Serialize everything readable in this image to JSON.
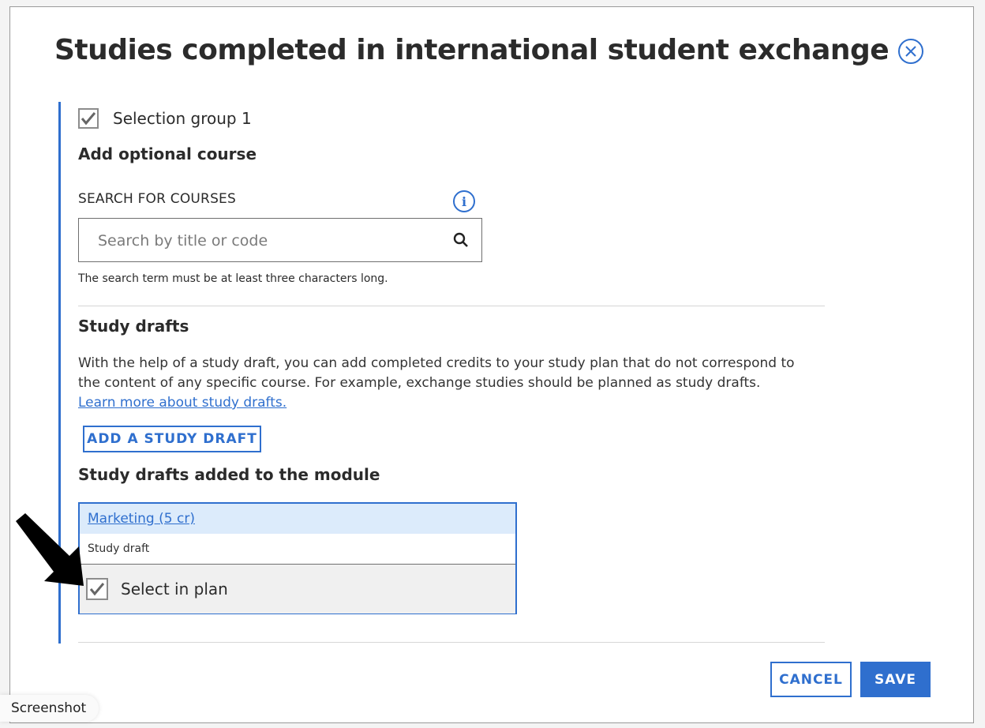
{
  "modal": {
    "title": "Studies completed in international student exchange"
  },
  "selection_group": {
    "label": "Selection group 1",
    "checked": true
  },
  "add_course": {
    "heading": "Add optional course",
    "search_label": "SEARCH FOR COURSES",
    "search_placeholder": "Search by title or code",
    "search_value": "",
    "hint": "The search term must be at least three characters long."
  },
  "study_drafts": {
    "heading": "Study drafts",
    "description": "With the help of a study draft, you can add completed credits to your study plan that do not correspond to the content of any specific course. For example, exchange studies should be planned as study drafts.",
    "learn_more": "Learn more about study drafts.",
    "add_button": "ADD A STUDY DRAFT"
  },
  "added_drafts": {
    "heading": "Study drafts added to the module",
    "items": [
      {
        "title": "Marketing (5 cr)",
        "subtitle": "Study draft",
        "select_label": "Select in plan",
        "checked": true
      }
    ]
  },
  "footer": {
    "cancel": "CANCEL",
    "save": "SAVE"
  },
  "overlay": {
    "tag": "Screenshot"
  },
  "colors": {
    "accent": "#2f6fce",
    "card_header_bg": "#dcebfb",
    "select_row_bg": "#f0f0f0"
  },
  "icons": [
    "close-icon",
    "info-icon",
    "search-icon",
    "checkmark-icon",
    "arrow-pointer"
  ]
}
